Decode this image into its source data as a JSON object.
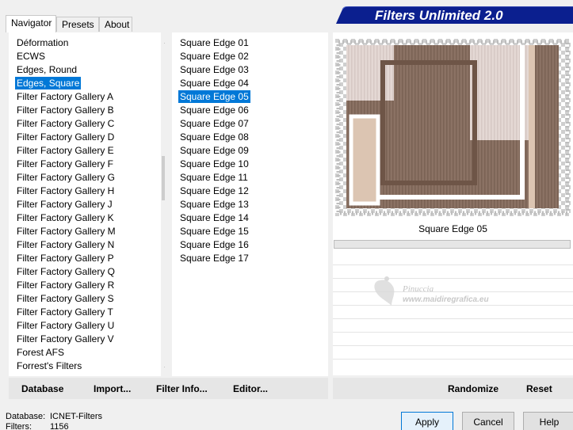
{
  "tabs": [
    "Navigator",
    "Presets",
    "About"
  ],
  "banner_title": "Filters Unlimited 2.0",
  "categories": [
    "Déformation",
    "ECWS",
    "Edges, Round",
    "Edges, Square",
    "Filter Factory Gallery A",
    "Filter Factory Gallery B",
    "Filter Factory Gallery C",
    "Filter Factory Gallery D",
    "Filter Factory Gallery E",
    "Filter Factory Gallery F",
    "Filter Factory Gallery G",
    "Filter Factory Gallery H",
    "Filter Factory Gallery J",
    "Filter Factory Gallery K",
    "Filter Factory Gallery M",
    "Filter Factory Gallery N",
    "Filter Factory Gallery P",
    "Filter Factory Gallery Q",
    "Filter Factory Gallery R",
    "Filter Factory Gallery S",
    "Filter Factory Gallery T",
    "Filter Factory Gallery U",
    "Filter Factory Gallery V",
    "Forest AFS",
    "Forrest's Filters"
  ],
  "selected_category": "Edges, Square",
  "filters": [
    "Square Edge 01",
    "Square Edge 02",
    "Square Edge 03",
    "Square Edge 04",
    "Square Edge 05",
    "Square Edge 06",
    "Square Edge 07",
    "Square Edge 08",
    "Square Edge 09",
    "Square Edge 10",
    "Square Edge 11",
    "Square Edge 12",
    "Square Edge 13",
    "Square Edge 14",
    "Square Edge 15",
    "Square Edge 16",
    "Square Edge 17"
  ],
  "selected_filter": "Square Edge 05",
  "preview_filter_name": "Square Edge 05",
  "watermark": {
    "line1": "Pinuccia",
    "line2": "www.maidiregrafica.eu"
  },
  "toolbar": {
    "database": "Database",
    "import": "Import...",
    "filter_info": "Filter Info...",
    "editor": "Editor...",
    "randomize": "Randomize",
    "reset": "Reset"
  },
  "status": {
    "database_label": "Database:",
    "database_value": "ICNET-Filters",
    "filters_label": "Filters:",
    "filters_value": "1156"
  },
  "buttons": {
    "apply": "Apply",
    "cancel": "Cancel",
    "help": "Help"
  },
  "colors": {
    "selection": "#0078d7",
    "banner": "#0b1f8f",
    "preview_brown": "#8b7264",
    "preview_light": "#dcc5b2"
  },
  "icons": {
    "scroll_up": "chevron-up-icon",
    "scroll_down": "chevron-down-icon"
  }
}
